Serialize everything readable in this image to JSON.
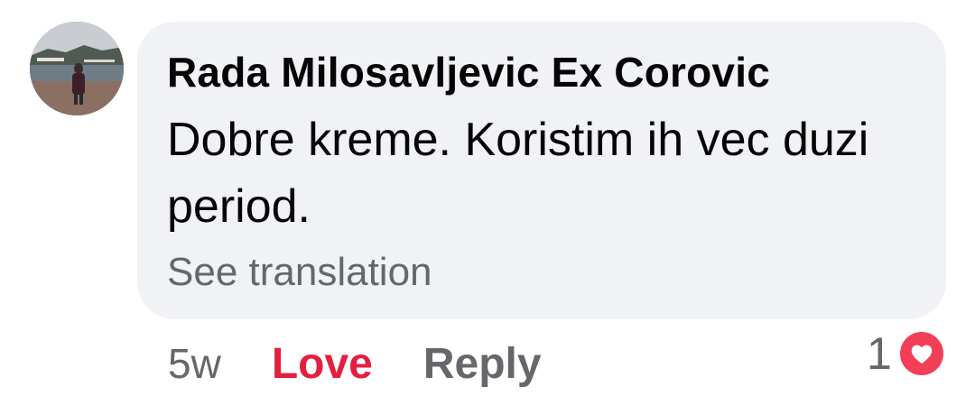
{
  "comment": {
    "author": "Rada Milosavljevic Ex Corovic",
    "text": "Dobre kreme. Koristim ih vec duzi period.",
    "see_translation": "See translation"
  },
  "actions": {
    "timestamp": "5w",
    "love": "Love",
    "reply": "Reply"
  },
  "reactions": {
    "count": "1",
    "icon": "heart-icon",
    "color": "#f33e58"
  },
  "colors": {
    "bubble": "#f0f2f5",
    "love_active": "#e41e3f",
    "secondary_text": "#65676b"
  }
}
